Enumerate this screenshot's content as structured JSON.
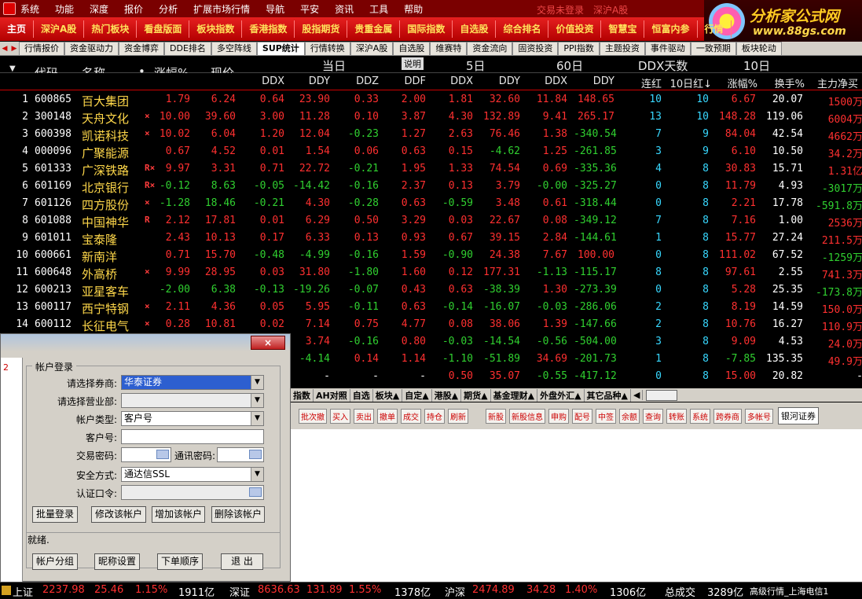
{
  "menubar": {
    "items": [
      "系统",
      "功能",
      "深度",
      "报价",
      "分析",
      "扩展市场行情",
      "导航",
      "平安",
      "资讯",
      "工具",
      "帮助"
    ],
    "trade_status": "交易未登录",
    "market": "深沪A股"
  },
  "brand": {
    "name": "分析家公式网",
    "url": "www.88gs.com"
  },
  "toolbar": {
    "items": [
      "主页",
      "深沪A股",
      "热门板块",
      "看盘版面",
      "板块指数",
      "香港指数",
      "股指期货",
      "贵重金属",
      "国际指数",
      "自选股",
      "综合排名",
      "价值投资",
      "智慧宝",
      "恒富内参",
      "行情"
    ]
  },
  "section_tabs": [
    "行情报价",
    "资金驱动力",
    "资金博弈",
    "DDE排名",
    "多空阵线",
    "SUP统计",
    "行情转换",
    "深沪A股",
    "自选股",
    "维赛特",
    "资金流向",
    "固资投资",
    "PPI指数",
    "主题投资",
    "事件驱动",
    "一致预期",
    "板块轮动"
  ],
  "header": {
    "code": "代码",
    "name": "名称",
    "dot": "•",
    "change_pct": "涨幅%",
    "price": "现价",
    "today": "当日",
    "explain": "说明",
    "day5": "5日",
    "day60": "60日",
    "ddx_days": "DDX天数",
    "day10": "10日",
    "ddx": "DDX",
    "ddy": "DDY",
    "ddz": "DDZ",
    "ddf": "DDF",
    "ddx5": "DDX",
    "ddy5": "DDY",
    "ddx60": "DDX",
    "ddy60": "DDY",
    "lianhong": "连红",
    "red10": "10日红↓",
    "chg10": "涨幅%",
    "turnover": "换手%",
    "netflow": "主力净买"
  },
  "rows": [
    {
      "i": "1",
      "code": "600865",
      "name": "百大集团",
      "flag": "",
      "chg": "1.79",
      "price": "6.24",
      "ddx": "0.64",
      "ddy": "23.90",
      "ddz": "0.33",
      "ddf": "2.00",
      "ddx5": "1.81",
      "ddy5": "32.60",
      "ddx60": "11.84",
      "ddy60": "148.65",
      "lh": "10",
      "r10": "10",
      "c10": "6.67",
      "to": "20.07",
      "nf": "1500万"
    },
    {
      "i": "2",
      "code": "300148",
      "name": "天舟文化",
      "flag": "×",
      "chg": "10.00",
      "price": "39.60",
      "ddx": "3.00",
      "ddy": "11.28",
      "ddz": "0.10",
      "ddf": "3.87",
      "ddx5": "4.30",
      "ddy5": "132.89",
      "ddx60": "9.41",
      "ddy60": "265.17",
      "lh": "13",
      "r10": "10",
      "c10": "148.28",
      "to": "119.06",
      "nf": "6004万"
    },
    {
      "i": "3",
      "code": "600398",
      "name": "凯诺科技",
      "flag": "×",
      "chg": "10.02",
      "price": "6.04",
      "ddx": "1.20",
      "ddy": "12.04",
      "ddz": "-0.23",
      "ddf": "1.27",
      "ddx5": "2.63",
      "ddy5": "76.46",
      "ddx60": "1.38",
      "ddy60": "-340.54",
      "lh": "7",
      "r10": "9",
      "c10": "84.04",
      "to": "42.54",
      "nf": "4662万"
    },
    {
      "i": "4",
      "code": "000096",
      "name": "广聚能源",
      "flag": "",
      "chg": "0.67",
      "price": "4.52",
      "ddx": "0.01",
      "ddy": "1.54",
      "ddz": "0.06",
      "ddf": "0.63",
      "ddx5": "0.15",
      "ddy5": "-4.62",
      "ddx60": "1.25",
      "ddy60": "-261.85",
      "lh": "3",
      "r10": "9",
      "c10": "6.10",
      "to": "10.50",
      "nf": "34.2万"
    },
    {
      "i": "5",
      "code": "601333",
      "name": "广深铁路",
      "flag": "R×",
      "chg": "9.97",
      "price": "3.31",
      "ddx": "0.71",
      "ddy": "22.72",
      "ddz": "-0.21",
      "ddf": "1.95",
      "ddx5": "1.33",
      "ddy5": "74.54",
      "ddx60": "0.69",
      "ddy60": "-335.36",
      "lh": "4",
      "r10": "8",
      "c10": "30.83",
      "to": "15.71",
      "nf": "1.31亿"
    },
    {
      "i": "6",
      "code": "601169",
      "name": "北京银行",
      "flag": "R×",
      "chg": "-0.12",
      "price": "8.63",
      "ddx": "-0.05",
      "ddy": "-14.42",
      "ddz": "-0.16",
      "ddf": "2.37",
      "ddx5": "0.13",
      "ddy5": "3.79",
      "ddx60": "-0.00",
      "ddy60": "-325.27",
      "lh": "0",
      "r10": "8",
      "c10": "11.79",
      "to": "4.93",
      "nf": "-3017万"
    },
    {
      "i": "7",
      "code": "601126",
      "name": "四方股份",
      "flag": "×",
      "chg": "-1.28",
      "price": "18.46",
      "ddx": "-0.21",
      "ddy": "4.30",
      "ddz": "-0.28",
      "ddf": "0.63",
      "ddx5": "-0.59",
      "ddy5": "3.48",
      "ddx60": "0.61",
      "ddy60": "-318.44",
      "lh": "0",
      "r10": "8",
      "c10": "2.21",
      "to": "17.78",
      "nf": "-591.8万"
    },
    {
      "i": "8",
      "code": "601088",
      "name": "中国神华",
      "flag": "R",
      "chg": "2.12",
      "price": "17.81",
      "ddx": "0.01",
      "ddy": "6.29",
      "ddz": "0.50",
      "ddf": "3.29",
      "ddx5": "0.03",
      "ddy5": "22.67",
      "ddx60": "0.08",
      "ddy60": "-349.12",
      "lh": "7",
      "r10": "8",
      "c10": "7.16",
      "to": "1.00",
      "nf": "2536万"
    },
    {
      "i": "9",
      "code": "601011",
      "name": "宝泰隆",
      "flag": "",
      "chg": "2.43",
      "price": "10.13",
      "ddx": "0.17",
      "ddy": "6.33",
      "ddz": "0.13",
      "ddf": "0.93",
      "ddx5": "0.67",
      "ddy5": "39.15",
      "ddx60": "2.84",
      "ddy60": "-144.61",
      "lh": "1",
      "r10": "8",
      "c10": "15.77",
      "to": "27.24",
      "nf": "211.5万"
    },
    {
      "i": "10",
      "code": "600661",
      "name": "新南洋",
      "flag": "",
      "chg": "0.71",
      "price": "15.70",
      "ddx": "-0.48",
      "ddy": "-4.99",
      "ddz": "-0.16",
      "ddf": "1.59",
      "ddx5": "-0.90",
      "ddy5": "24.38",
      "ddx60": "7.67",
      "ddy60": "100.00",
      "lh": "0",
      "r10": "8",
      "c10": "111.02",
      "to": "67.52",
      "nf": "-1259万"
    },
    {
      "i": "11",
      "code": "600648",
      "name": "外高桥",
      "flag": "×",
      "chg": "9.99",
      "price": "28.95",
      "ddx": "0.03",
      "ddy": "31.80",
      "ddz": "-1.80",
      "ddf": "1.60",
      "ddx5": "0.12",
      "ddy5": "177.31",
      "ddx60": "-1.13",
      "ddy60": "-115.17",
      "lh": "8",
      "r10": "8",
      "c10": "97.61",
      "to": "2.55",
      "nf": "741.3万"
    },
    {
      "i": "12",
      "code": "600213",
      "name": "亚星客车",
      "flag": "",
      "chg": "-2.00",
      "price": "6.38",
      "ddx": "-0.13",
      "ddy": "-19.26",
      "ddz": "-0.07",
      "ddf": "0.43",
      "ddx5": "0.63",
      "ddy5": "-38.39",
      "ddx60": "1.30",
      "ddy60": "-273.39",
      "lh": "0",
      "r10": "8",
      "c10": "5.28",
      "to": "25.35",
      "nf": "-173.8万"
    },
    {
      "i": "13",
      "code": "600117",
      "name": "西宁特钢",
      "flag": "×",
      "chg": "2.11",
      "price": "4.36",
      "ddx": "0.05",
      "ddy": "5.95",
      "ddz": "-0.11",
      "ddf": "0.63",
      "ddx5": "-0.14",
      "ddy5": "-16.07",
      "ddx60": "-0.03",
      "ddy60": "-286.06",
      "lh": "2",
      "r10": "8",
      "c10": "8.19",
      "to": "14.59",
      "nf": "150.0万"
    },
    {
      "i": "14",
      "code": "600112",
      "name": "长征电气",
      "flag": "×",
      "chg": "0.28",
      "price": "10.81",
      "ddx": "0.02",
      "ddy": "7.14",
      "ddz": "0.75",
      "ddf": "4.77",
      "ddx5": "0.08",
      "ddy5": "38.06",
      "ddx60": "1.39",
      "ddy60": "-147.66",
      "lh": "2",
      "r10": "8",
      "c10": "10.76",
      "to": "16.27",
      "nf": "110.9万"
    },
    {
      "i": "",
      "code": "",
      "name": "",
      "flag": "",
      "chg": "",
      "price": "",
      "ddx": "",
      "ddy": "3.74",
      "ddz": "-0.16",
      "ddf": "0.80",
      "ddx5": "-0.03",
      "ddy5": "-14.54",
      "ddx60": "-0.56",
      "ddy60": "-504.00",
      "lh": "3",
      "r10": "8",
      "c10": "9.09",
      "to": "4.53",
      "nf": "24.0万"
    },
    {
      "i": "",
      "code": "",
      "name": "",
      "flag": "",
      "chg": "",
      "price": "",
      "ddx": "",
      "ddy": "-4.14",
      "ddz": "0.14",
      "ddf": "1.14",
      "ddx5": "-1.10",
      "ddy5": "-51.89",
      "ddx60": "34.69",
      "ddy60": "-201.73",
      "lh": "1",
      "r10": "8",
      "c10": "-7.85",
      "to": "135.35",
      "nf": "49.9万"
    },
    {
      "i": "",
      "code": "",
      "name": "",
      "flag": "",
      "chg": "",
      "price": "",
      "ddx": "",
      "ddy": "-",
      "ddz": "-",
      "ddf": "-",
      "ddx5": "0.50",
      "ddy5": "35.07",
      "ddx60": "-0.55",
      "ddy60": "-417.12",
      "lh": "0",
      "r10": "8",
      "c10": "15.00",
      "to": "20.82",
      "nf": "-"
    }
  ],
  "bottom_tabs": [
    "指数",
    "AH对照",
    "自选",
    "板块▲",
    "自定▲",
    "港股▲",
    "期货▲",
    "基金理财▲",
    "外盘外汇▲",
    "其它品种▲"
  ],
  "trade_buttons": [
    "批次撤",
    "买入",
    "卖出",
    "撤单",
    "成交",
    "持仓",
    "刷新",
    "新股",
    "新股信息",
    "申购",
    "配号",
    "中签",
    "余额",
    "查询",
    "转账",
    "系统",
    "跨券商",
    "多帐号"
  ],
  "broker_field": "银河证券",
  "dialog": {
    "close": "×",
    "left_number": "2",
    "group_title": "帐户登录",
    "broker_label": "请选择券商:",
    "broker_value": "华泰证券",
    "branch_label": "请选择营业部:",
    "branch_value": "",
    "acct_type_label": "帐户类型:",
    "acct_type_value": "客户号",
    "client_no_label": "客户号:",
    "client_no_value": "",
    "trade_pwd_label": "交易密码:",
    "comm_pwd_label": "通讯密码:",
    "security_label": "安全方式:",
    "security_value": "通达信SSL",
    "auth_label": "认证口令:",
    "btn_batch": "批量登录",
    "btn_modify": "修改该帐户",
    "btn_add": "增加该帐户",
    "btn_delete": "删除该帐户",
    "ready": "就绪.",
    "btn_group": "帐户分组",
    "btn_nick": "昵称设置",
    "btn_order": "下单顺序",
    "btn_exit": "退 出"
  },
  "statusbar": {
    "sh_label": "上证",
    "sh_index": "2237.98",
    "sh_chg": "25.46",
    "sh_pct": "1.15%",
    "sh_vol": "1911亿",
    "sz_label": "深证",
    "sz_index": "8636.63",
    "sz_chg": "131.89",
    "sz_pct": "1.55%",
    "sz_vol": "1378亿",
    "hs_label": "沪深",
    "hs_index": "2474.89",
    "hs_chg": "34.28",
    "hs_pct": "1.40%",
    "hs_vol": "1306亿",
    "total_label": "总成交",
    "total_vol": "3289亿",
    "feed": "高级行情_上海电信1"
  }
}
